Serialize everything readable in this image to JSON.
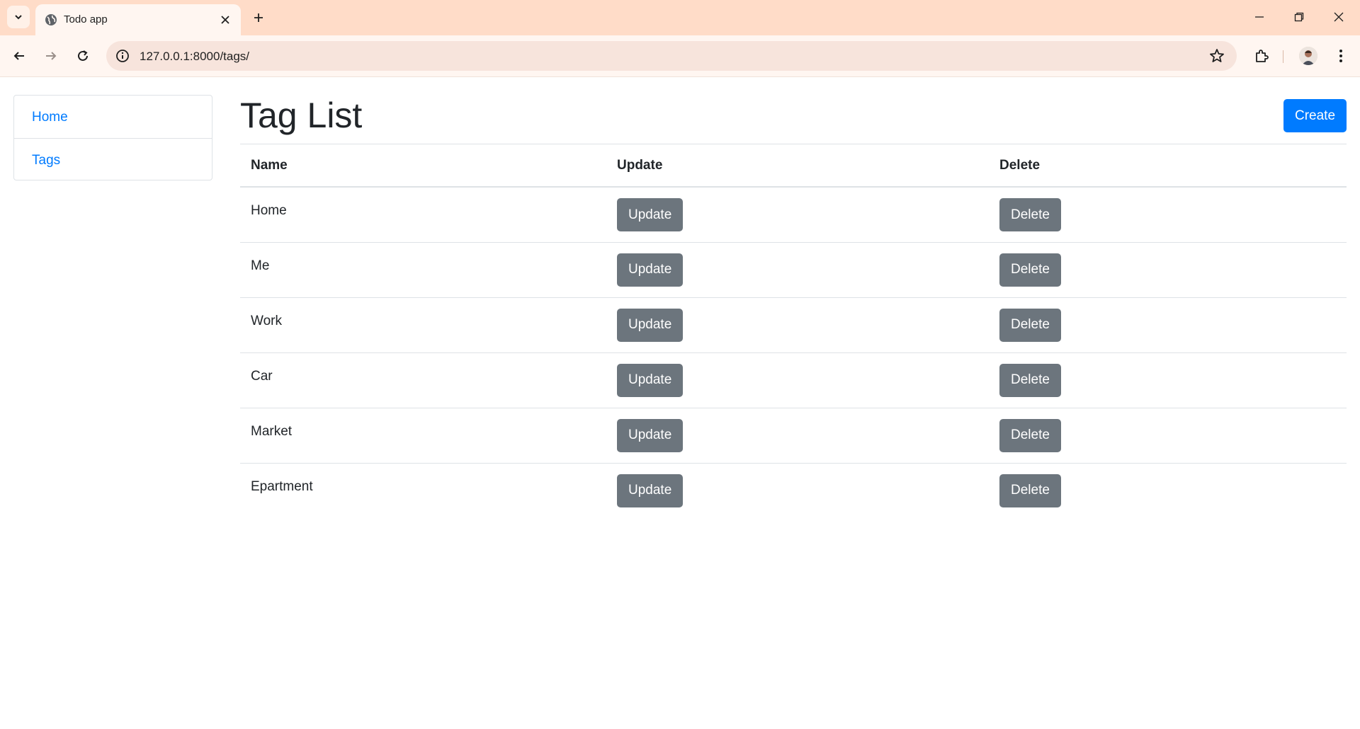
{
  "browser": {
    "tab_title": "Todo app",
    "url": "127.0.0.1:8000/tags/"
  },
  "sidebar": {
    "items": [
      {
        "label": "Home"
      },
      {
        "label": "Tags"
      }
    ]
  },
  "main": {
    "title": "Tag List",
    "create_label": "Create",
    "columns": [
      "Name",
      "Update",
      "Delete"
    ],
    "rows": [
      {
        "name": "Home",
        "update": "Update",
        "delete": "Delete"
      },
      {
        "name": "Me",
        "update": "Update",
        "delete": "Delete"
      },
      {
        "name": "Work",
        "update": "Update",
        "delete": "Delete"
      },
      {
        "name": "Car",
        "update": "Update",
        "delete": "Delete"
      },
      {
        "name": "Market",
        "update": "Update",
        "delete": "Delete"
      },
      {
        "name": "Epartment",
        "update": "Update",
        "delete": "Delete"
      }
    ]
  },
  "colors": {
    "primary": "#007bff",
    "secondary": "#6c757d",
    "chrome": "#ffdcc8"
  }
}
